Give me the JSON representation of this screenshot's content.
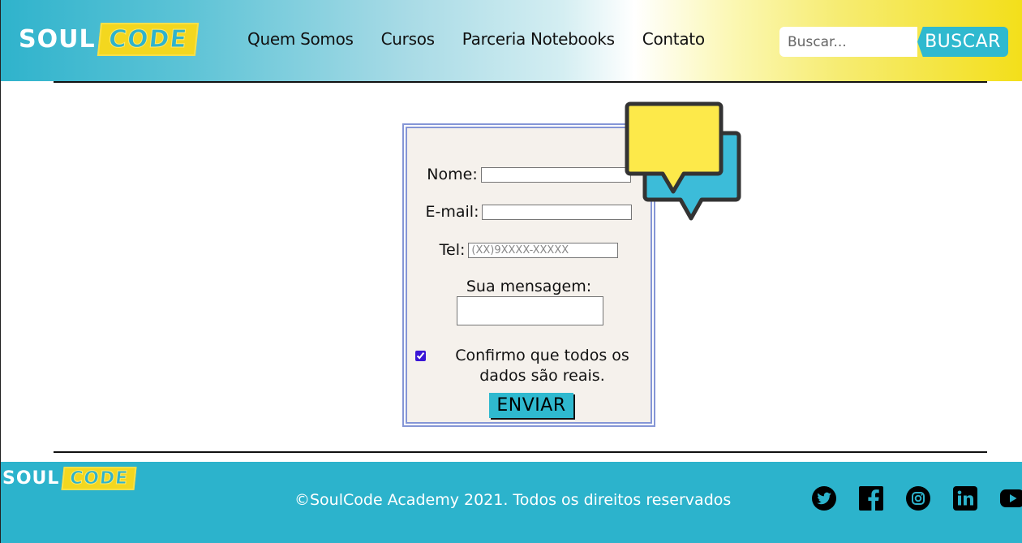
{
  "header": {
    "logo": {
      "soul": "SOUL",
      "code": "CODE"
    },
    "nav": [
      "Quem Somos",
      "Cursos",
      "Parceria Notebooks",
      "Contato"
    ],
    "search": {
      "placeholder": "Buscar...",
      "button_label": "BUSCAR"
    }
  },
  "form": {
    "name_label": "Nome:",
    "email_label": "E-mail:",
    "phone_label": "Tel:",
    "phone_placeholder": "(XX)9XXXX-XXXXX",
    "message_label": "Sua mensagem:",
    "confirm_label": "Confirmo que todos os dados são reais.",
    "confirm_checked": true,
    "submit_label": "ENVIAR"
  },
  "footer": {
    "logo": {
      "soul": "SOUL",
      "code": "CODE"
    },
    "copyright": "©SoulCode Academy 2021. Todos os direitos reservados",
    "social_icons": [
      "twitter-icon",
      "facebook-icon",
      "instagram-icon",
      "linkedin-icon",
      "youtube-icon"
    ]
  },
  "colors": {
    "accent_blue": "#2fb3cc",
    "accent_yellow": "#f3d71f",
    "form_border": "#8596d6",
    "form_bg": "#f5f1ec"
  }
}
